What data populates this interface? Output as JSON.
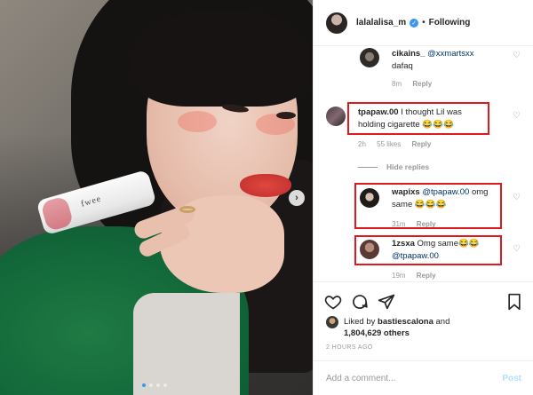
{
  "photo": {
    "lipstick_brand": "fwee"
  },
  "header": {
    "username": "lalalalisa_m",
    "verified_glyph": "✓",
    "separator": "•",
    "follow_label": "Following"
  },
  "comments": [
    {
      "user": "cikains_",
      "mention": "@xxmartsxx",
      "text": "dafaq",
      "time": "8m",
      "reply_label": "Reply"
    },
    {
      "user": "tpapaw.00",
      "text_line1": "I thought Lil was",
      "text_line2": "holding cigarette 😂😂😂",
      "time": "2h",
      "likes": "55 likes",
      "reply_label": "Reply"
    },
    {
      "user": "wapixs",
      "mention": "@tpapaw.00",
      "text_line1": "omg",
      "text_line2": "same 😂😂😂",
      "time": "31m",
      "reply_label": "Reply"
    },
    {
      "user": "1zsxa",
      "text_line1": "Omg same😂😂",
      "mention": "@tpapaw.00",
      "time": "19m",
      "reply_label": "Reply"
    }
  ],
  "hide_replies_label": "Hide replies",
  "actions": {
    "liked_by_prefix": "Liked by",
    "liked_by_user": "bastiescalona",
    "and_word": "and",
    "others_count": "1,804,629 others",
    "timestamp": "2 HOURS AGO"
  },
  "comment_box": {
    "placeholder": "Add a comment...",
    "post_label": "Post"
  },
  "colors": {
    "highlight_box": "#e0181f",
    "link": "#003569",
    "verified": "#3897f0",
    "post_disabled": "#b2dffc"
  },
  "icons": {
    "like": "heart-icon",
    "comment": "comment-icon",
    "share": "share-icon",
    "save": "bookmark-icon",
    "next": "chevron-right-icon"
  },
  "carousel": {
    "pages": 4,
    "current": 1
  }
}
